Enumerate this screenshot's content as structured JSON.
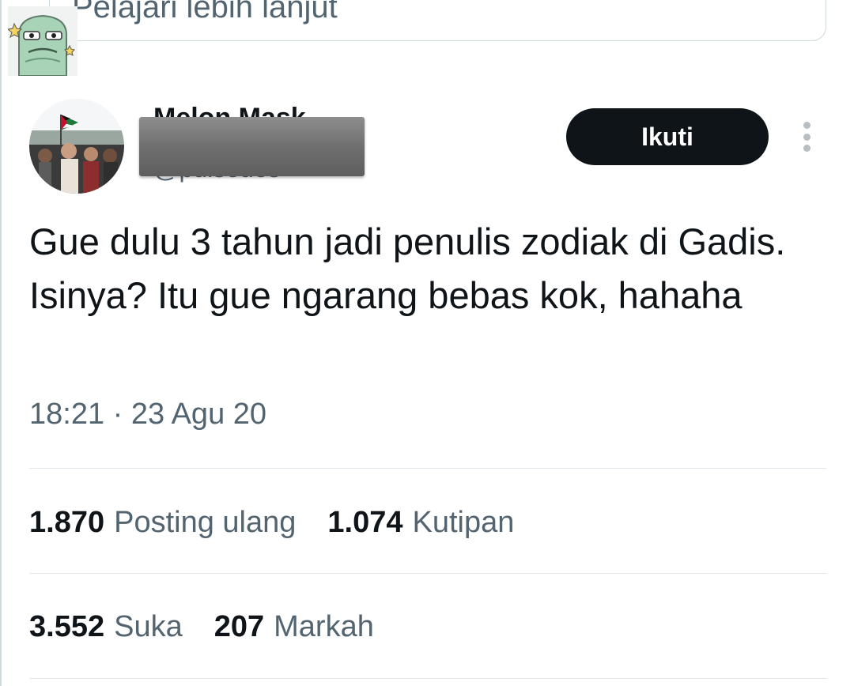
{
  "top_card": {
    "text": "Pelajari lebih lanjut"
  },
  "header": {
    "display_name": "Melon Mask",
    "username": "@pulsedes",
    "follow_label": "Ikuti"
  },
  "tweet": {
    "text": "Gue dulu 3 tahun jadi penulis zodiak di Gadis. Isinya? Itu gue ngarang bebas kok, hahaha",
    "timestamp": "18:21 · 23 Agu 20"
  },
  "stats": {
    "reposts_count": "1.870",
    "reposts_label": "Posting ulang",
    "quotes_count": "1.074",
    "quotes_label": "Kutipan",
    "likes_count": "3.552",
    "likes_label": "Suka",
    "bookmarks_count": "207",
    "bookmarks_label": "Markah"
  },
  "colors": {
    "text_primary": "#0f1419",
    "text_secondary": "#536471",
    "button_bg": "#0f1419",
    "divider": "#e1e8ed"
  }
}
